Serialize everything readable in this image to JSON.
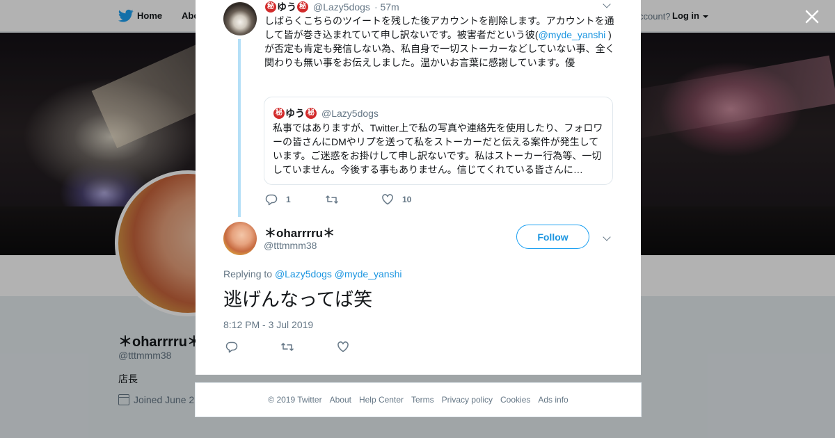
{
  "topbar": {
    "home": "Home",
    "about": "Abo",
    "have_account": "ccount?",
    "login": "Log in"
  },
  "profile": {
    "name": "＊oharrrru＊",
    "handle": "@tttmmm38",
    "bio": "店長",
    "joined": "Joined June 2"
  },
  "parent_tweet": {
    "name": "ゆう",
    "badge": "秘",
    "handle": "@Lazy5dogs",
    "time": "· 57m",
    "text_before_link": "しばらくこちらのツイートを残した後アカウントを削除します。アカウントを通して皆が巻き込まれていて申し訳ないです。被害者だという彼(",
    "link": "@myde_yanshi",
    "text_after_link": " )が否定も肯定も発信しない為、私自身で一切ストーカーなどしていない事、全く関わりも無い事をお伝えしました。温かいお言葉に感謝しています。優",
    "quote": {
      "name": "ゆう",
      "badge": "秘",
      "handle": "@Lazy5dogs",
      "text": "私事ではありますが、Twitter上で私の写真や連絡先を使用したり、フォロワーの皆さんにDMやリプを送って私をストーカーだと伝える案件が発生しています。ご迷惑をお掛けして申し訳ないです。私はストーカー行為等、一切していません。今後する事もありません。信じてくれている皆さんに…"
    },
    "replies": "1",
    "retweets": "",
    "likes": "10"
  },
  "main_tweet": {
    "name": "＊oharrrru＊",
    "handle": "@tttmmm38",
    "follow_label": "Follow",
    "replying_to_label": "Replying to",
    "replying_to_1": "@Lazy5dogs",
    "replying_to_2": "@myde_yanshi",
    "text": "逃げんなってば笑",
    "date": "8:12 PM - 3 Jul 2019"
  },
  "footer": {
    "links": [
      "© 2019 Twitter",
      "About",
      "Help Center",
      "Terms",
      "Privacy policy",
      "Cookies",
      "Ads info"
    ]
  },
  "colors": {
    "brand": "#1da1f2",
    "link": "#1b95e0",
    "secondary_text": "#657786",
    "thread_line": "#b4dff7"
  }
}
